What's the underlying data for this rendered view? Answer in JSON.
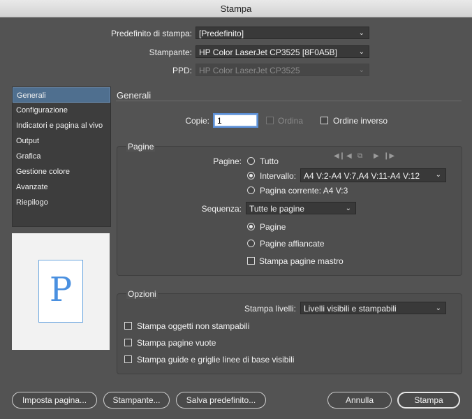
{
  "window": {
    "title": "Stampa"
  },
  "header": {
    "preset_label": "Predefinito di stampa:",
    "preset_value": "[Predefinito]",
    "printer_label": "Stampante:",
    "printer_value": "HP Color LaserJet CP3525 [8F0A5B]",
    "ppd_label": "PPD:",
    "ppd_value": "HP Color LaserJet CP3525"
  },
  "sidebar": {
    "items": [
      {
        "label": "Generali"
      },
      {
        "label": "Configurazione"
      },
      {
        "label": "Indicatori e pagina al vivo"
      },
      {
        "label": "Output"
      },
      {
        "label": "Grafica"
      },
      {
        "label": "Gestione colore"
      },
      {
        "label": "Avanzate"
      },
      {
        "label": "Riepilogo"
      }
    ],
    "preview_letter": "P"
  },
  "main": {
    "section_title": "Generali",
    "copies_label": "Copie:",
    "copies_value": "1",
    "collate_label": "Ordina",
    "reverse_label": "Ordine inverso",
    "pages_group": {
      "title": "Pagine",
      "pages_label": "Pagine:",
      "all_label": "Tutto",
      "range_label": "Intervallo:",
      "range_value": "A4 V:2-A4 V:7,A4 V:11-A4 V:12",
      "current_label": "Pagina corrente: A4 V:3",
      "sequence_label": "Sequenza:",
      "sequence_value": "Tutte le pagine",
      "pages_option": "Pagine",
      "spreads_option": "Pagine affiancate",
      "master_label": "Stampa pagine mastro"
    },
    "options_group": {
      "title": "Opzioni",
      "layers_label": "Stampa livelli:",
      "layers_value": "Livelli visibili e stampabili",
      "nonprinting_label": "Stampa oggetti non stampabili",
      "blank_label": "Stampa pagine vuote",
      "guides_label": "Stampa guide e griglie linee di base visibili"
    }
  },
  "footer": {
    "page_setup": "Imposta pagina...",
    "printer": "Stampante...",
    "save_preset": "Salva predefinito...",
    "cancel": "Annulla",
    "print": "Stampa"
  }
}
